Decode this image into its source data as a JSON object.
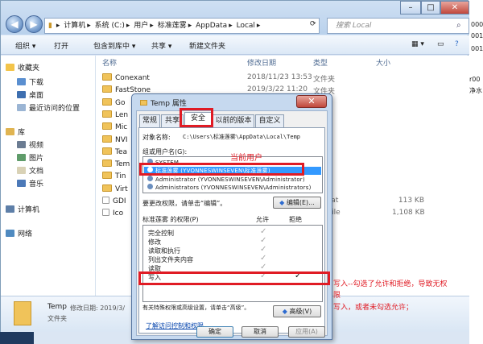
{
  "explorer": {
    "address": [
      "计算机",
      "系统 (C:)",
      "用户",
      "标准莲雾",
      "AppData",
      "Local"
    ],
    "search_placeholder": "搜索 Local",
    "toolbar": [
      "组织 ▾",
      "打开",
      "包含到库中 ▾",
      "共享 ▾",
      "新建文件夹"
    ],
    "sidebar": {
      "favorites": "收藏夹",
      "fav_items": [
        "下载",
        "桌面",
        "最近访问的位置"
      ],
      "library": "库",
      "lib_items": [
        "视频",
        "图片",
        "文档",
        "音乐"
      ],
      "computer": "计算机",
      "network": "网络"
    },
    "columns": {
      "name": "名称",
      "date": "修改日期",
      "type": "类型",
      "size": "大小"
    },
    "rows": [
      {
        "name": "Conexant",
        "date": "2018/11/23 13:53",
        "type": "文件夹",
        "size": ""
      },
      {
        "name": "FastStone",
        "date": "2019/3/22 11:20",
        "type": "文件夹",
        "size": ""
      },
      {
        "name": "Go",
        "date": "",
        "type": "",
        "size": ""
      },
      {
        "name": "Len",
        "date": "",
        "type": "",
        "size": ""
      },
      {
        "name": "Mic",
        "date": "",
        "type": "",
        "size": ""
      },
      {
        "name": "NVI",
        "date": "",
        "type": "",
        "size": ""
      },
      {
        "name": "Tea",
        "date": "",
        "type": "",
        "size": ""
      },
      {
        "name": "Tem",
        "date": "",
        "type": "",
        "size": ""
      },
      {
        "name": "Tin",
        "date": "",
        "type": "",
        "size": ""
      },
      {
        "name": "Virt",
        "date": "",
        "type": "",
        "size": ""
      },
      {
        "name": "GDI",
        "date": "",
        "type": "ver.dat",
        "size": "113 KB"
      },
      {
        "name": "Ico",
        "date": "",
        "type": "ase File",
        "size": "1,108 KB"
      }
    ],
    "details": {
      "name": "Temp",
      "modified_label": "修改日期: 2019/3/",
      "type": "文件夹"
    }
  },
  "dialog": {
    "title": "Temp 属性",
    "close": "✕",
    "tabs": [
      "常规",
      "共享",
      "安全",
      "以前的版本",
      "自定义"
    ],
    "object_label": "对象名称:",
    "object_value": "C:\\Users\\标准莲雾\\AppData\\Local\\Temp",
    "group_label": "组或用户名(G):",
    "users": [
      "SYSTEM",
      "标准莲雾 (YVONNESWINSEVEN\\标准莲雾)",
      "Administrator (YVONNESWINSEVEN\\Administrator)",
      "Administrators (YVONNESWINSEVEN\\Administrators)"
    ],
    "change_hint": "要更改权限，请单击“编辑”。",
    "edit_button": "编辑(E)...",
    "perm_label": "标准莲雾 的权限(P)",
    "allow": "允许",
    "deny": "拒绝",
    "permissions": [
      {
        "name": "完全控制",
        "allow": true,
        "deny": false
      },
      {
        "name": "修改",
        "allow": true,
        "deny": false
      },
      {
        "name": "读取和执行",
        "allow": true,
        "deny": false
      },
      {
        "name": "列出文件夹内容",
        "allow": true,
        "deny": false
      },
      {
        "name": "读取",
        "allow": true,
        "deny": false
      },
      {
        "name": "写入",
        "allow": true,
        "deny": true
      }
    ],
    "special_hint": "有关特殊权限或高级设置，请单击“高级”。",
    "advanced_button": "高级(V)",
    "learn_link": "了解访问控制和权限",
    "ok": "确定",
    "cancel": "取消",
    "apply": "应用(A)",
    "check": "✓"
  },
  "annotations": {
    "current_user": "当前用户",
    "write_note_1": "写入--勾选了允许和拒绝，导致无权",
    "write_note_1b": "限",
    "write_note_2": "写入，或者未勾选允许；"
  },
  "right_strip": [
    "000",
    "001",
    "001",
    "r00",
    "净水"
  ]
}
